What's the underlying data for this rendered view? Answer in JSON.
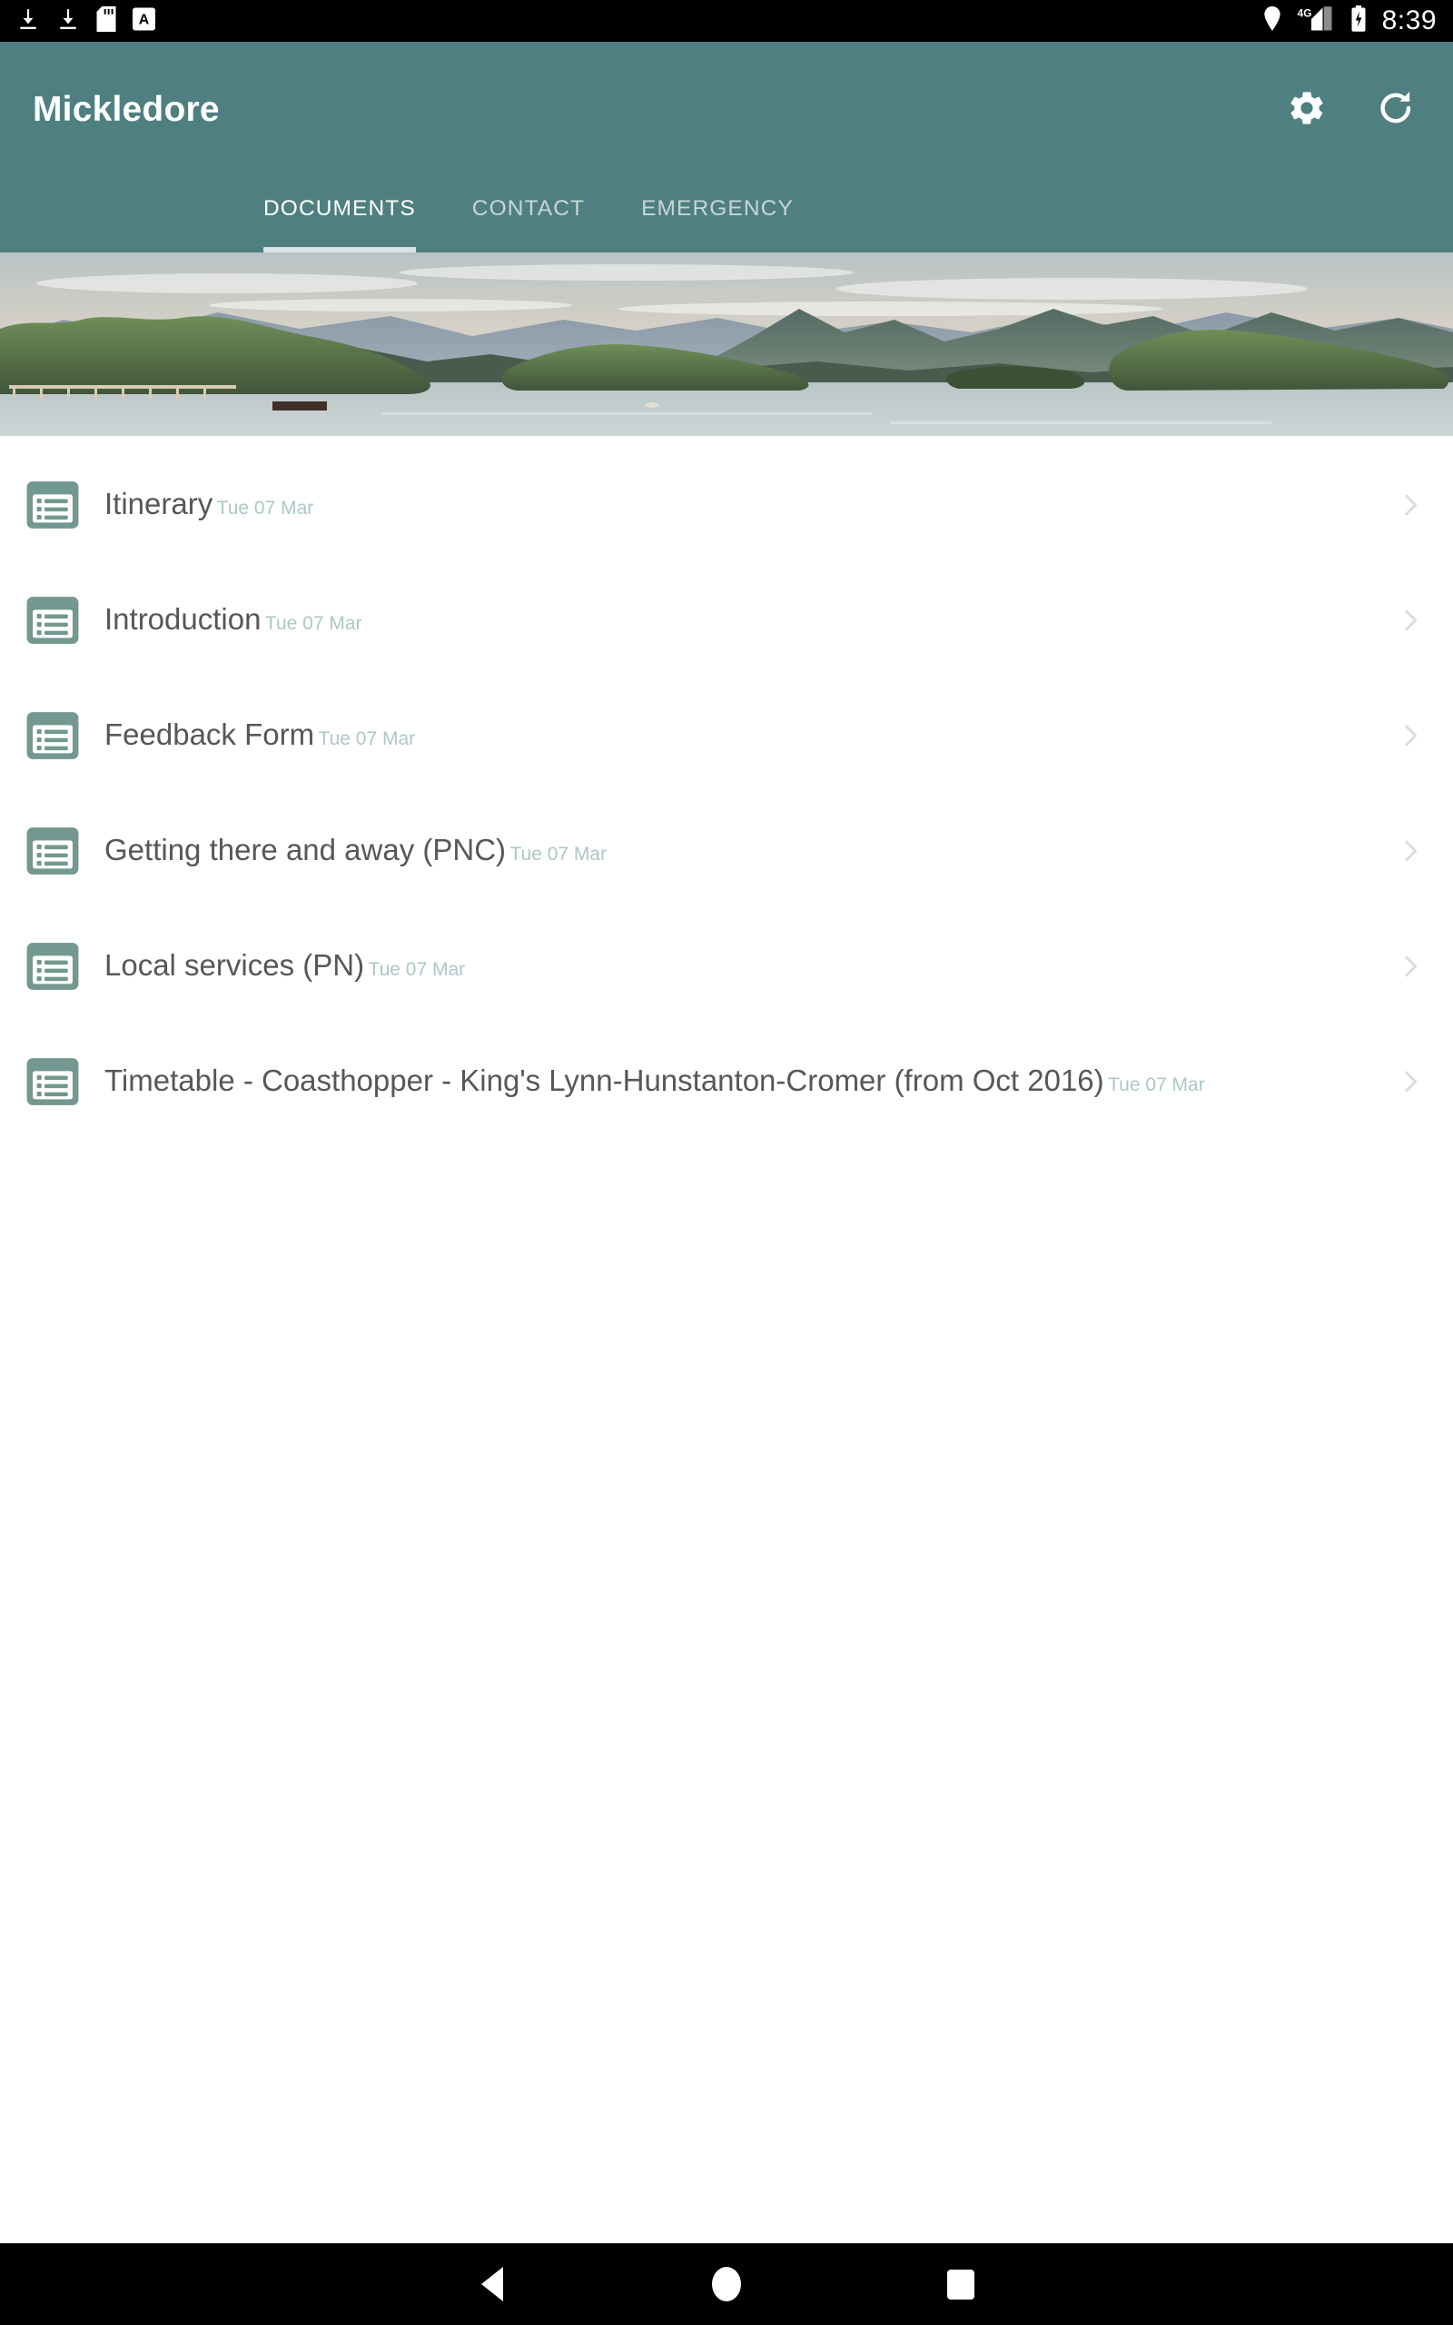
{
  "status_bar": {
    "icons_left": [
      "download-icon",
      "download-icon",
      "sd-card-icon",
      "screenshot-a-icon"
    ],
    "location_icon": "location-pin-icon",
    "network_label": "4G",
    "signal_icon": "signal-bars-icon",
    "battery_icon": "battery-charging-icon",
    "time": "8:39"
  },
  "appbar": {
    "title": "Mickledore",
    "background_color": "#4f7f80",
    "settings_label": "Settings",
    "refresh_label": "Refresh"
  },
  "tabs": {
    "active_index": 0,
    "items": [
      {
        "label": "DOCUMENTS"
      },
      {
        "label": "CONTACT"
      },
      {
        "label": "EMERGENCY"
      }
    ]
  },
  "hero": {
    "alt": "Lake with wooded islands and mountains at dusk"
  },
  "documents": {
    "items": [
      {
        "title": "Itinerary",
        "date": "Tue 07 Mar"
      },
      {
        "title": "Introduction",
        "date": "Tue 07 Mar"
      },
      {
        "title": "Feedback Form",
        "date": "Tue 07 Mar"
      },
      {
        "title": "Getting there and away (PNC)",
        "date": "Tue 07 Mar"
      },
      {
        "title": "Local services (PN)",
        "date": "Tue 07 Mar"
      },
      {
        "title": "Timetable - Coasthopper - King's Lynn-Hunstanton-Cromer (from Oct 2016)",
        "date": "Tue 07 Mar"
      }
    ]
  },
  "navbar": {
    "back_label": "Back",
    "home_label": "Home",
    "recents_label": "Recents"
  }
}
